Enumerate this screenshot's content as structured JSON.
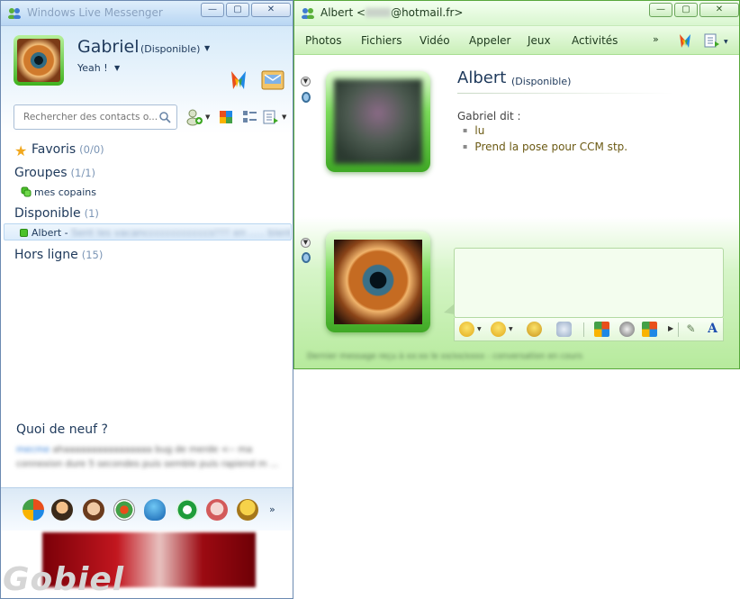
{
  "left_window": {
    "title": "Windows Live Messenger",
    "controls": {
      "minimize": "—",
      "maximize": "▢",
      "close": "✕"
    },
    "user": {
      "name": "Gabriel",
      "status": "(Disponible)",
      "personal_message": "Yeah !"
    },
    "search": {
      "placeholder": "Rechercher des contacts o..."
    },
    "groups": [
      {
        "title": "Favoris",
        "count": "(0/0)"
      },
      {
        "title": "Groupes",
        "count": "(1/1)",
        "items": [
          "mes copains"
        ]
      },
      {
        "title": "Disponible",
        "count": "(1)",
        "items": [
          {
            "name": "Albert -",
            "message": "Sent les vacanccccccccccccs!!!! en ..... bientt"
          }
        ]
      },
      {
        "title": "Hors ligne",
        "count": "(15)"
      }
    ],
    "whats_new": {
      "title": "Quoi de neuf ?",
      "link": "mecme",
      "text": "ahaaaaaaaaaaaaaaaa bug de merde <-- ma connexion dure 5 secondes puis semble puis rapiend m ..."
    },
    "watermark": "Gobiel",
    "more_label": "»"
  },
  "right_window": {
    "title_prefix": "Albert <",
    "title_suffix": "@hotmail.fr>",
    "controls": {
      "minimize": "—",
      "maximize": "▢",
      "close": "✕"
    },
    "menu": [
      "Photos",
      "Fichiers",
      "Vidéo",
      "Appeler",
      "Jeux",
      "Activités"
    ],
    "menu_more": "»",
    "contact": {
      "name": "Albert",
      "status": "(Disponible)"
    },
    "conversation": {
      "sender_line": "Gabriel dit :",
      "messages": [
        "lu",
        "Prend la pose pour CCM stp."
      ]
    },
    "compose": {
      "value": ""
    },
    "status_bar": "Dernier message reçu à xx:xx le xx/xx/xxxx - conversation en cours"
  },
  "colors": {
    "status_online": "#4cc22a",
    "left_accent": "#1e395b",
    "right_accent": "#3fa825"
  }
}
